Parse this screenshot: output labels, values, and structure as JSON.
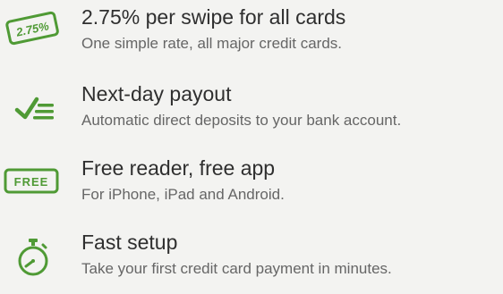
{
  "accent_color": "#4f9a35",
  "features": [
    {
      "icon": "rate-tag-icon",
      "icon_text": "2.75%",
      "title": "2.75% per swipe for all cards",
      "description": "One simple rate, all major credit cards."
    },
    {
      "icon": "checklist-icon",
      "title": "Next-day payout",
      "description": "Automatic direct deposits to your bank account."
    },
    {
      "icon": "free-tag-icon",
      "icon_text": "FREE",
      "title": "Free reader, free app",
      "description": "For iPhone, iPad and Android."
    },
    {
      "icon": "stopwatch-icon",
      "title": "Fast setup",
      "description": "Take your first credit card payment in minutes."
    }
  ]
}
